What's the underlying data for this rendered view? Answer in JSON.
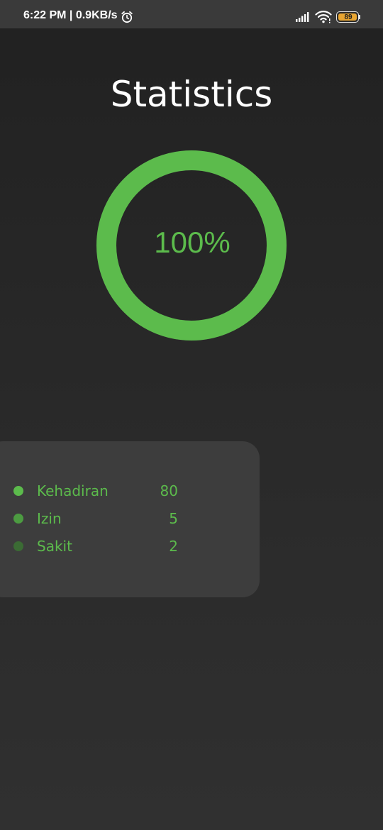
{
  "status_bar": {
    "time_network": "6:22 PM | 0.9KB/s",
    "icons": [
      "alarm-icon",
      "signal-icon",
      "wifi-icon",
      "battery-icon"
    ],
    "battery_level": "89",
    "battery_color": "#e8a531"
  },
  "header": {
    "title": "Statistics"
  },
  "progress": {
    "value_percent": 100,
    "label": "100%",
    "ring_color": "#5cbb4c",
    "track_color": "#3a3a3a"
  },
  "stats": {
    "items": [
      {
        "label": "Kehadiran",
        "value": "80",
        "dot_color": "#5cbb4c"
      },
      {
        "label": "Izin",
        "value": "5",
        "dot_color": "#4c9b41"
      },
      {
        "label": "Sakit",
        "value": "2",
        "dot_color": "#3b6b34"
      }
    ]
  },
  "colors": {
    "accent": "#5cbb4c",
    "card_bg": "#3d3d3d"
  }
}
